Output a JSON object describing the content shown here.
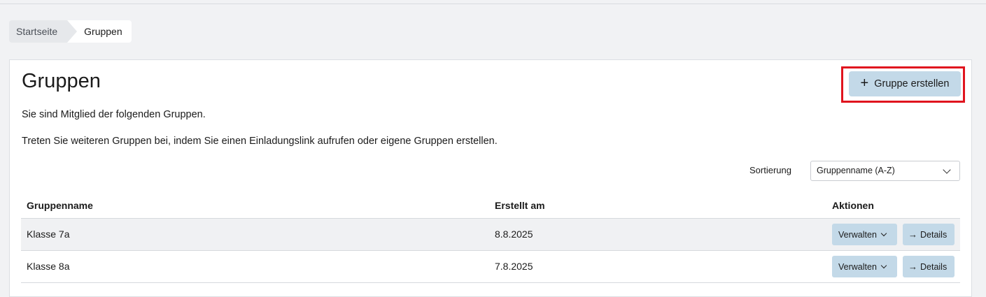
{
  "breadcrumb": {
    "home": "Startseite",
    "current": "Gruppen"
  },
  "page": {
    "title": "Gruppen",
    "description1": "Sie sind Mitglied der folgenden Gruppen.",
    "description2": "Treten Sie weiteren Gruppen bei, indem Sie einen Einladungslink aufrufen oder eigene Gruppen erstellen.",
    "create_button": "Gruppe erstellen"
  },
  "sort": {
    "label": "Sortierung",
    "selected": "Gruppenname (A-Z)"
  },
  "table": {
    "headers": {
      "name": "Gruppenname",
      "created": "Erstellt am",
      "actions": "Aktionen"
    },
    "rows": [
      {
        "name": "Klasse 7a",
        "created": "8.8.2025",
        "manage": "Verwalten",
        "details": "Details"
      },
      {
        "name": "Klasse 8a",
        "created": "7.8.2025",
        "manage": "Verwalten",
        "details": "Details"
      }
    ]
  },
  "colors": {
    "accent_button": "#c3d9e8",
    "highlight": "#e0141e",
    "page_bg": "#f1f2f4"
  },
  "icons": {
    "create": "plus-icon",
    "sort": "chevron-down-icon",
    "details": "arrow-right-icon"
  }
}
